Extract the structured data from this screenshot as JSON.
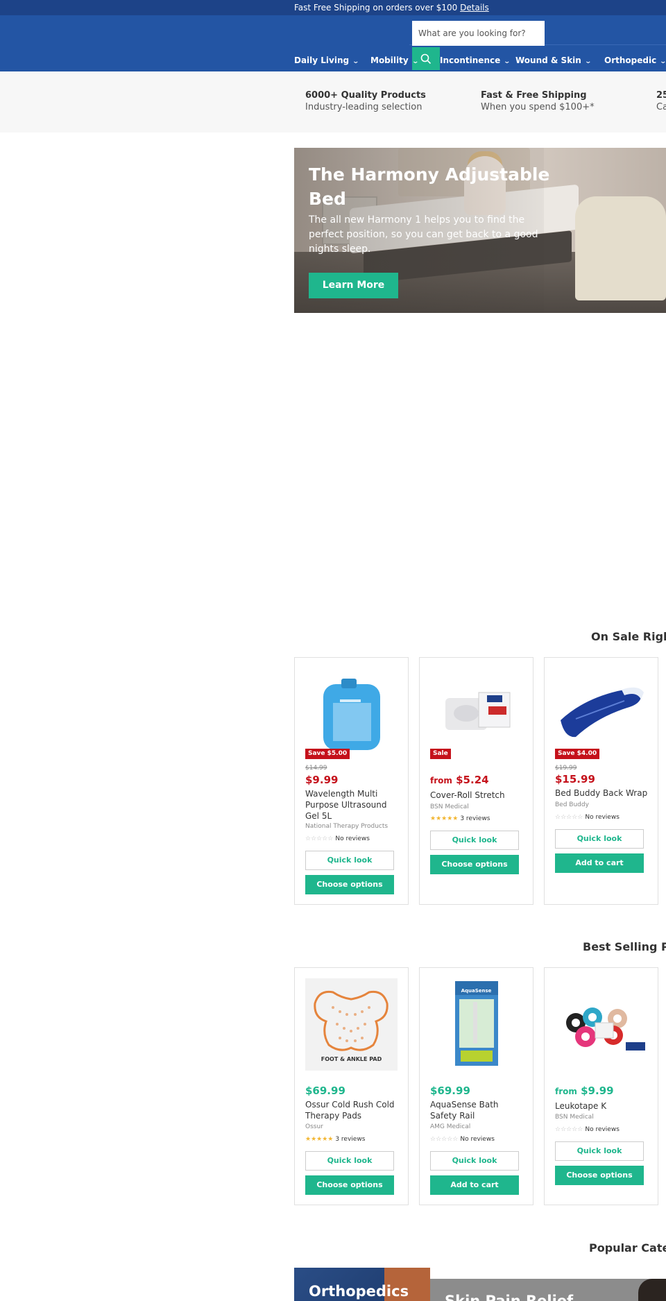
{
  "announcement": {
    "text": "Fast Free Shipping on orders over $100",
    "link": "Details"
  },
  "search": {
    "placeholder": "What are you looking for?"
  },
  "nav": [
    {
      "label": "Daily Living"
    },
    {
      "label": "Mobility"
    },
    {
      "label": "Incontinence"
    },
    {
      "label": "Wound & Skin"
    },
    {
      "label": "Orthopedic"
    }
  ],
  "benefits": [
    {
      "title": "6000+ Quality Products",
      "subtitle": "Industry-leading selection"
    },
    {
      "title": "Fast & Free Shipping",
      "subtitle": "When you spend $100+*"
    },
    {
      "title": "25",
      "subtitle": "Ca"
    }
  ],
  "hero": {
    "title": "The Harmony Adjustable Bed",
    "text": "The all new Harmony 1 helps you to find the perfect position, so you can get back to a good nights sleep.",
    "button": "Learn More"
  },
  "sections": {
    "on_sale": "On Sale Righ",
    "best_selling": "Best Selling Pr",
    "popular": "Popular Cate"
  },
  "sale_products": [
    {
      "badge": "Save $5.00",
      "was": "$14.99",
      "price": "$9.99",
      "title": "Wavelength Multi Purpose Ultrasound Gel 5L",
      "vendor": "National Therapy Products",
      "stars": "☆☆☆☆☆",
      "reviews": "No reviews",
      "btn1": "Quick look",
      "btn2": "Choose options"
    },
    {
      "badge": "Sale",
      "from": "from",
      "price": "$5.24",
      "title": "Cover-Roll Stretch",
      "vendor": "BSN Medical",
      "stars": "★★★★★",
      "reviews": "3 reviews",
      "btn1": "Quick look",
      "btn2": "Choose options"
    },
    {
      "badge": "Save $4.00",
      "was": "$19.99",
      "price": "$15.99",
      "title": "Bed Buddy Back Wrap",
      "vendor": "Bed Buddy",
      "stars": "☆☆☆☆☆",
      "reviews": "No reviews",
      "btn1": "Quick look",
      "btn2": "Add to cart"
    }
  ],
  "best_products": [
    {
      "image_caption": "FOOT & ANKLE PAD",
      "price": "$69.99",
      "title": "Ossur Cold Rush Cold Therapy Pads",
      "vendor": "Ossur",
      "stars": "★★★★★",
      "reviews": "3 reviews",
      "btn1": "Quick look",
      "btn2": "Choose options"
    },
    {
      "image_caption": "AquaSense",
      "price": "$69.99",
      "title": "AquaSense Bath Safety Rail",
      "vendor": "AMG Medical",
      "stars": "☆☆☆☆☆",
      "reviews": "No reviews",
      "btn1": "Quick look",
      "btn2": "Add to cart"
    },
    {
      "from": "from",
      "price": "$9.99",
      "title": "Leukotape K",
      "vendor": "BSN Medical",
      "stars": "☆☆☆☆☆",
      "reviews": "No reviews",
      "btn1": "Quick look",
      "btn2": "Choose options"
    }
  ],
  "categories": [
    {
      "label": "Orthopedics"
    },
    {
      "label": "Skin Pain Relief"
    }
  ],
  "colors": {
    "header": "#2355a4",
    "topbar": "#1d4388",
    "accent": "#1fb68d",
    "sale": "#c5111b"
  }
}
